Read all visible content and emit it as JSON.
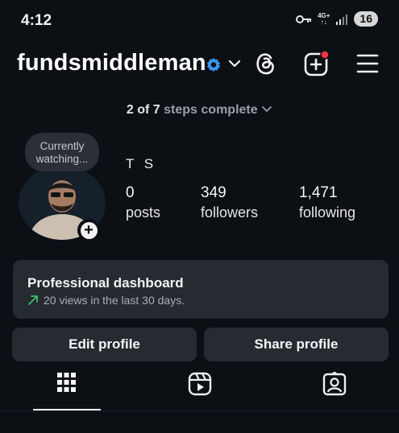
{
  "status_bar": {
    "time": "4:12",
    "network_type_top": "4G+",
    "network_type_bottom": "↑↓",
    "battery": "16",
    "icons": [
      "key-icon",
      "signal-icon"
    ]
  },
  "header": {
    "username": "fundsmiddleman",
    "icons": [
      "verified-badge-icon",
      "chevron-down-icon",
      "threads-icon",
      "new-post-icon",
      "menu-icon"
    ],
    "accent_color": "#3897f0",
    "notification_color": "#ff3040"
  },
  "steps": {
    "count": "2 of 7",
    "label": "steps complete"
  },
  "profile": {
    "note_line1": "Currently",
    "note_line2": "watching...",
    "display_name": "T S",
    "stats": [
      {
        "value": "0",
        "label": "posts"
      },
      {
        "value": "349",
        "label": "followers"
      },
      {
        "value": "1,471",
        "label": "following"
      }
    ]
  },
  "dashboard": {
    "title": "Professional dashboard",
    "subtitle": "20 views in the last 30 days.",
    "trend_color": "#3fbf6a"
  },
  "buttons": {
    "edit": "Edit profile",
    "share": "Share profile"
  },
  "tabs": [
    "grid-icon",
    "reels-icon",
    "tagged-icon"
  ],
  "colors": {
    "background": "#0c0f14",
    "card": "#262a31"
  }
}
